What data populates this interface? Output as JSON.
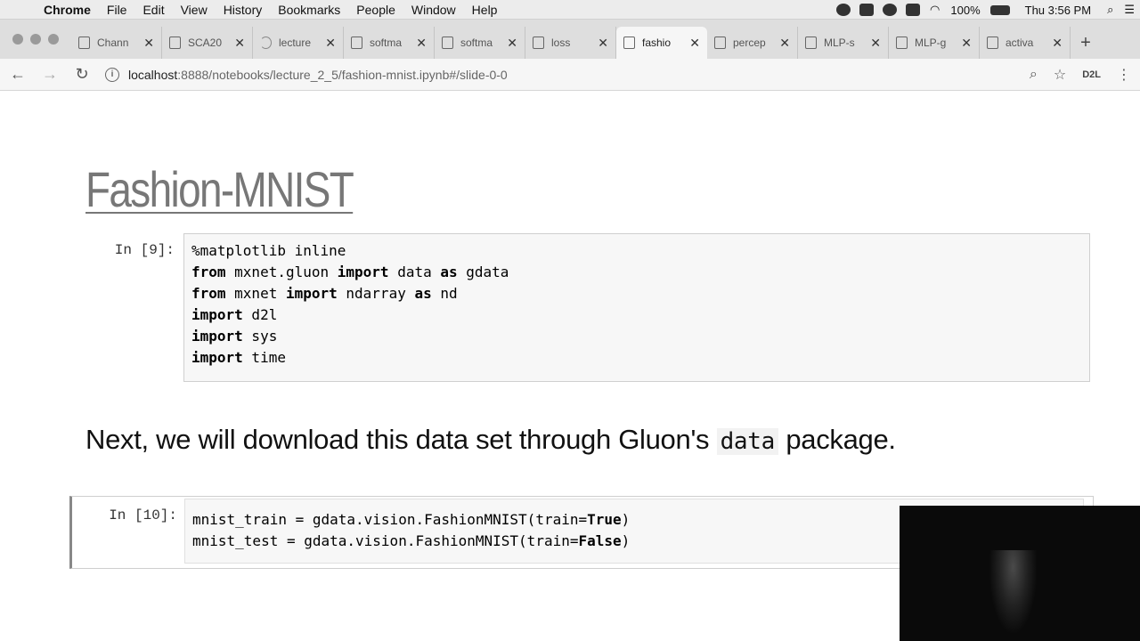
{
  "menubar": {
    "app": "Chrome",
    "items": [
      "File",
      "Edit",
      "View",
      "History",
      "Bookmarks",
      "People",
      "Window",
      "Help"
    ],
    "battery": "100%",
    "clock": "Thu 3:56 PM"
  },
  "tabs": [
    {
      "label": "Chann",
      "icon": "youtube-icon"
    },
    {
      "label": "SCA20",
      "icon": "document-icon"
    },
    {
      "label": "lecture",
      "icon": "loading-icon"
    },
    {
      "label": "softma",
      "icon": "notebook-icon"
    },
    {
      "label": "softma",
      "icon": "notebook-icon"
    },
    {
      "label": "loss",
      "icon": "notebook-icon"
    },
    {
      "label": "fashio",
      "icon": "notebook-icon",
      "active": true
    },
    {
      "label": "percep",
      "icon": "notebook-icon"
    },
    {
      "label": "MLP-s",
      "icon": "notebook-icon"
    },
    {
      "label": "MLP-g",
      "icon": "notebook-icon"
    },
    {
      "label": "activa",
      "icon": "notebook-icon"
    }
  ],
  "address": {
    "host": "localhost",
    "path": ":8888/notebooks/lecture_2_5/fashion-mnist.ipynb#/slide-0-0",
    "extension": "D2L"
  },
  "notebook": {
    "title": "Fashion-MNIST",
    "cell1_prompt": "In [9]:",
    "cell1_lines": [
      [
        {
          "t": "%matplotlib inline",
          "c": ""
        }
      ],
      [
        {
          "t": "from",
          "c": "kw"
        },
        {
          "t": " mxnet.gluon ",
          "c": ""
        },
        {
          "t": "import",
          "c": "kw"
        },
        {
          "t": " data ",
          "c": ""
        },
        {
          "t": "as",
          "c": "kw"
        },
        {
          "t": " gdata",
          "c": ""
        }
      ],
      [
        {
          "t": "from",
          "c": "kw"
        },
        {
          "t": " mxnet ",
          "c": ""
        },
        {
          "t": "import",
          "c": "kw"
        },
        {
          "t": " ndarray ",
          "c": ""
        },
        {
          "t": "as",
          "c": "kw"
        },
        {
          "t": " nd",
          "c": ""
        }
      ],
      [
        {
          "t": "import",
          "c": "kw"
        },
        {
          "t": " d2l",
          "c": ""
        }
      ],
      [
        {
          "t": "import",
          "c": "kw"
        },
        {
          "t": " sys",
          "c": ""
        }
      ],
      [
        {
          "t": "import",
          "c": "kw"
        },
        {
          "t": " time",
          "c": ""
        }
      ]
    ],
    "markdown_before": "Next, we will download this data set through Gluon's ",
    "markdown_code": "data",
    "markdown_after": " package.",
    "cell2_prompt": "In [10]:",
    "cell2_lines": [
      [
        {
          "t": "mnist_train = gdata.vision.FashionMNIST(train=",
          "c": ""
        },
        {
          "t": "True",
          "c": "bl"
        },
        {
          "t": ")",
          "c": ""
        }
      ],
      [
        {
          "t": "mnist_test = gdata.vision.FashionMNIST(train=",
          "c": ""
        },
        {
          "t": "False",
          "c": "bl"
        },
        {
          "t": ")",
          "c": ""
        }
      ]
    ]
  }
}
